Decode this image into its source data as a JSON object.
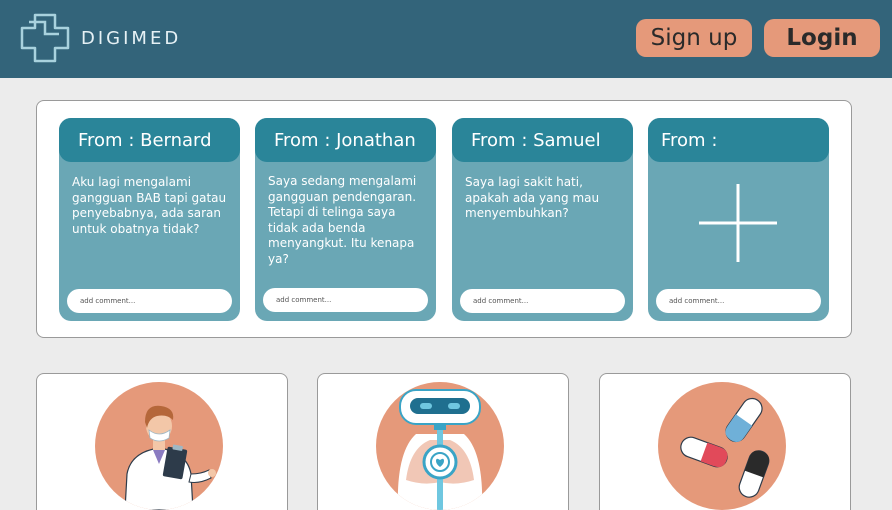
{
  "header": {
    "brand": "DIGIMED",
    "signup_label": "Sign up",
    "login_label": "Login"
  },
  "questions": [
    {
      "from": "From : Bernard",
      "text": "Aku lagi mengalami gangguan BAB tapi gatau penyebabnya, ada saran untuk obatnya tidak?",
      "comment_placeholder": "add comment..."
    },
    {
      "from": "From : Jonathan",
      "text": "Saya sedang mengalami gangguan pendengaran. Tetapi di telinga saya tidak ada benda menyangkut. Itu kenapa ya?",
      "comment_placeholder": "add comment..."
    },
    {
      "from": "From : Samuel",
      "text": "Saya lagi sakit hati, apakah ada yang mau menyembuhkan?",
      "comment_placeholder": "add comment..."
    },
    {
      "from": "From :",
      "text": "",
      "comment_placeholder": "add comment..."
    }
  ],
  "features": [
    {
      "icon": "doctor-icon"
    },
    {
      "icon": "robot-icon"
    },
    {
      "icon": "pills-icon"
    }
  ],
  "colors": {
    "header": "#33647a",
    "card_head": "#2a8599",
    "card_body": "#6aa7b5",
    "accent": "#e5997a"
  }
}
